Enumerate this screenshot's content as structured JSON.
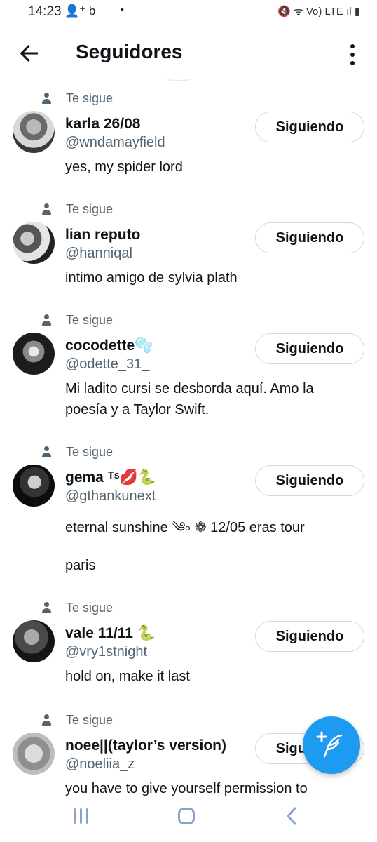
{
  "status_bar": {
    "time": "14:23",
    "left_icons": "👤⁺ b",
    "dot": "•",
    "right_icons": "🔇 ᯤ Vo) LTE ıl ▮"
  },
  "header": {
    "title": "Seguidores",
    "back_icon": "arrow-left-icon",
    "menu_icon": "more-vertical-icon"
  },
  "follows_you_label": "Te sigue",
  "follow_button_label": "Siguiendo",
  "followers": [
    {
      "name": "karla 26/08",
      "handle": "@wndamayfield",
      "bio": "yes, my spider lord"
    },
    {
      "name": "lian reputo",
      "handle": "@hanniqal",
      "bio": "intimo amigo de sylvia plath"
    },
    {
      "name": "cocodette🫧",
      "handle": "@odette_31_",
      "bio": "Mi ladito cursi se desborda aquí. Amo la poesía y a Taylor Swift."
    },
    {
      "name": "gema ᵀˢ💋🐍",
      "handle": "@gthankunext",
      "bio": "eternal sunshine ༄৹ ❁ 12/05 eras tour",
      "bio2": "paris"
    },
    {
      "name": "vale 11/11 🐍",
      "handle": "@vry1stnight",
      "bio": "hold on, make it last"
    },
    {
      "name": "noee||(taylor’s version)",
      "handle": "@noeliia_z",
      "bio": "you have to give yourself permission to"
    }
  ],
  "colors": {
    "accent": "#1d9bf0",
    "text_primary": "#0f1419",
    "text_secondary": "#536471",
    "border": "#cfd9de"
  },
  "fab": {
    "icon": "compose-feather-icon"
  },
  "nav": {
    "recent_icon": "recent-apps-icon",
    "home_icon": "home-icon",
    "back_icon": "back-icon"
  }
}
